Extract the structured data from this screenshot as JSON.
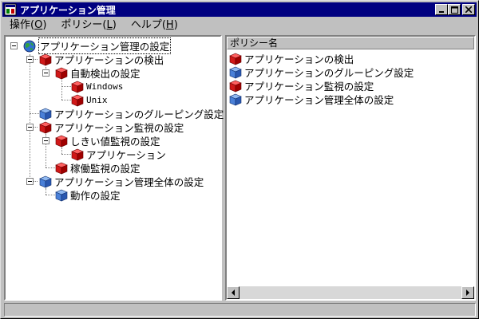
{
  "window": {
    "title": "アプリケーション管理"
  },
  "menu": [
    {
      "label": "操作",
      "accel": "O"
    },
    {
      "label": "ポリシー",
      "accel": "L"
    },
    {
      "label": "ヘルプ",
      "accel": "H"
    }
  ],
  "tree": {
    "root": {
      "label": "アプリケーション管理の設定",
      "icon": "globe-icon"
    },
    "detect": {
      "label": "アプリケーションの検出",
      "icon": "red-cube-icon"
    },
    "auto_detect": {
      "label": "自動検出の設定",
      "icon": "red-cube-icon"
    },
    "windows": {
      "label": "Windows",
      "icon": "red-cube-icon"
    },
    "unix": {
      "label": "Unix",
      "icon": "red-cube-icon"
    },
    "grouping": {
      "label": "アプリケーションのグルーピング設定",
      "icon": "blue-cube-icon"
    },
    "monitor": {
      "label": "アプリケーション監視の設定",
      "icon": "red-cube-icon"
    },
    "threshold": {
      "label": "しきい値監視の設定",
      "icon": "red-cube-icon"
    },
    "application": {
      "label": "アプリケーション",
      "icon": "red-cube-icon"
    },
    "uptime": {
      "label": "稼働監視の設定",
      "icon": "red-cube-icon"
    },
    "overall": {
      "label": "アプリケーション管理全体の設定",
      "icon": "blue-cube-icon"
    },
    "operation": {
      "label": "動作の設定",
      "icon": "blue-cube-icon"
    }
  },
  "list": {
    "header": "ポリシー名",
    "rows": [
      {
        "label": "アプリケーションの検出",
        "icon": "red-cube-icon"
      },
      {
        "label": "アプリケーションのグルーピング設定",
        "icon": "blue-cube-icon"
      },
      {
        "label": "アプリケーション監視の設定",
        "icon": "red-cube-icon"
      },
      {
        "label": "アプリケーション管理全体の設定",
        "icon": "blue-cube-icon"
      }
    ]
  },
  "colors": {
    "titlebar": "#000080",
    "red_cube": "#e02020",
    "blue_cube": "#3a78d8"
  }
}
